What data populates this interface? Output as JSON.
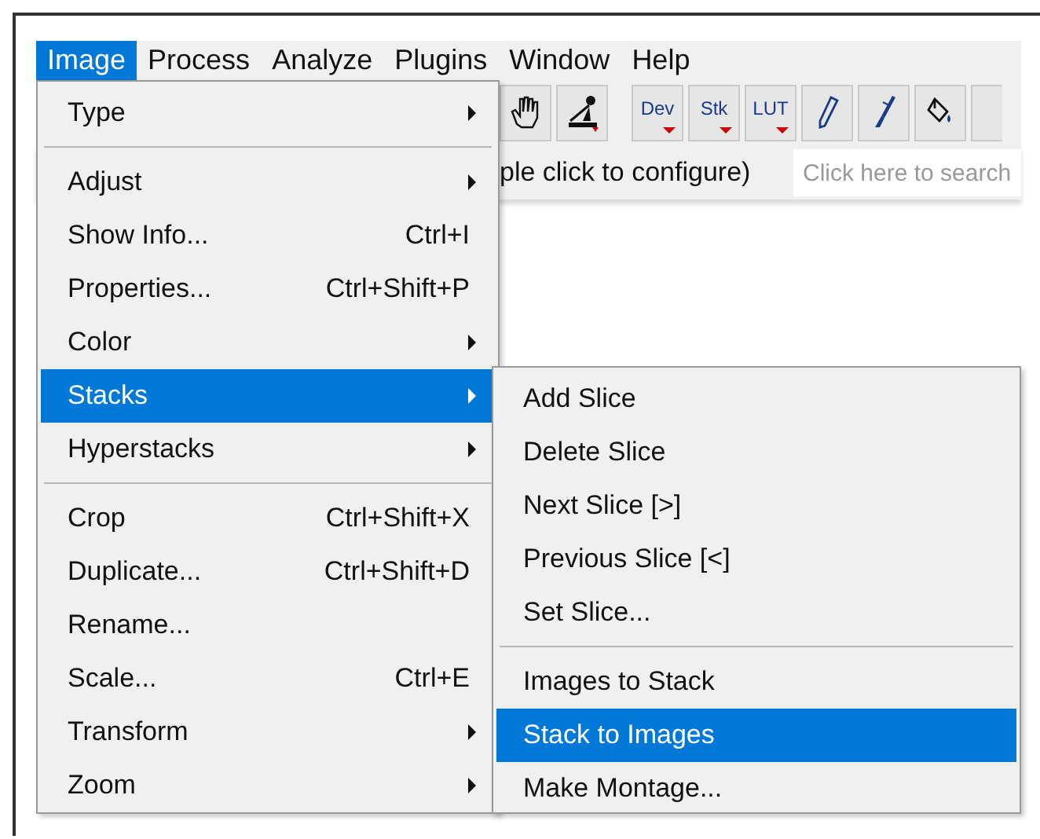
{
  "menu_bar": [
    {
      "label": "Image",
      "selected": true
    },
    {
      "label": "Process",
      "selected": false
    },
    {
      "label": "Analyze",
      "selected": false
    },
    {
      "label": "Plugins",
      "selected": false
    },
    {
      "label": "Window",
      "selected": false
    },
    {
      "label": "Help",
      "selected": false
    }
  ],
  "toolbar": [
    {
      "kind": "hand"
    },
    {
      "kind": "angle"
    },
    {
      "kind": "gap"
    },
    {
      "kind": "menu",
      "label": "Dev"
    },
    {
      "kind": "menu",
      "label": "Stk"
    },
    {
      "kind": "menu",
      "label": "LUT"
    },
    {
      "kind": "pencil"
    },
    {
      "kind": "brush"
    },
    {
      "kind": "fill"
    },
    {
      "kind": "blank"
    }
  ],
  "status": {
    "text": "ple click to configure)"
  },
  "search": {
    "placeholder": "Click here to search"
  },
  "menu": {
    "items": [
      {
        "kind": "item",
        "label": "Type",
        "submenu": true,
        "selected": false
      },
      {
        "kind": "separator"
      },
      {
        "kind": "item",
        "label": "Adjust",
        "submenu": true,
        "selected": false
      },
      {
        "kind": "item",
        "label": "Show Info...",
        "shortcut": "Ctrl+I",
        "submenu": false,
        "selected": false
      },
      {
        "kind": "item",
        "label": "Properties...",
        "shortcut": "Ctrl+Shift+P",
        "submenu": false,
        "selected": false
      },
      {
        "kind": "item",
        "label": "Color",
        "submenu": true,
        "selected": false
      },
      {
        "kind": "item",
        "label": "Stacks",
        "submenu": true,
        "selected": true
      },
      {
        "kind": "item",
        "label": "Hyperstacks",
        "submenu": true,
        "selected": false
      },
      {
        "kind": "separator"
      },
      {
        "kind": "item",
        "label": "Crop",
        "shortcut": "Ctrl+Shift+X",
        "submenu": false,
        "selected": false
      },
      {
        "kind": "item",
        "label": "Duplicate...",
        "shortcut": "Ctrl+Shift+D",
        "submenu": false,
        "selected": false
      },
      {
        "kind": "item",
        "label": "Rename...",
        "submenu": false,
        "selected": false
      },
      {
        "kind": "item",
        "label": "Scale...",
        "shortcut": "Ctrl+E",
        "submenu": false,
        "selected": false
      },
      {
        "kind": "item",
        "label": "Transform",
        "submenu": true,
        "selected": false
      },
      {
        "kind": "item",
        "label": "Zoom",
        "submenu": true,
        "selected": false
      }
    ]
  },
  "submenu": {
    "items": [
      {
        "kind": "item",
        "label": "Add Slice",
        "selected": false
      },
      {
        "kind": "item",
        "label": "Delete Slice",
        "selected": false
      },
      {
        "kind": "item",
        "label": "Next Slice [>]",
        "selected": false
      },
      {
        "kind": "item",
        "label": "Previous Slice [<]",
        "selected": false
      },
      {
        "kind": "item",
        "label": "Set Slice...",
        "selected": false
      },
      {
        "kind": "separator"
      },
      {
        "kind": "item",
        "label": "Images to Stack",
        "selected": false
      },
      {
        "kind": "item",
        "label": "Stack to Images",
        "selected": true
      },
      {
        "kind": "item",
        "label": "Make Montage...",
        "selected": false
      }
    ]
  }
}
